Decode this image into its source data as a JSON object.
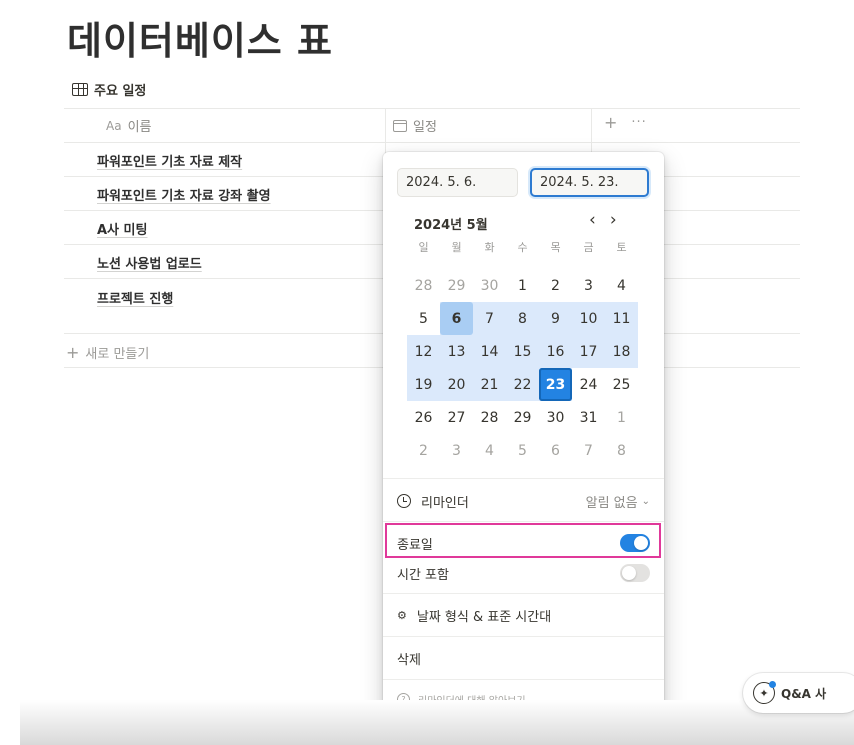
{
  "page": {
    "title": "데이터베이스 표"
  },
  "view": {
    "name": "주요 일정"
  },
  "table": {
    "name_column": {
      "icon_text": "Aa",
      "label": "이름"
    },
    "date_column": {
      "label": "일정"
    },
    "add_column": "+",
    "more": "···",
    "rows": [
      {
        "name": "파워포인트 기초 자료 제작"
      },
      {
        "name": "파워포인트 기초 자료 강좌 촬영"
      },
      {
        "name": "A사 미팅"
      },
      {
        "name": "노션 사용법 업로드"
      },
      {
        "name": "프로젝트 진행"
      }
    ],
    "new_row": "새로 만들기"
  },
  "date_picker": {
    "start_value": "2024. 5. 6.",
    "end_value": "2024. 5. 23.",
    "month_label": "2024년 5월",
    "prev": "‹",
    "next": "›",
    "weekdays": [
      "일",
      "월",
      "화",
      "수",
      "목",
      "금",
      "토"
    ],
    "weeks": [
      [
        "28",
        "29",
        "30",
        "1",
        "2",
        "3",
        "4"
      ],
      [
        "5",
        "6",
        "7",
        "8",
        "9",
        "10",
        "11"
      ],
      [
        "12",
        "13",
        "14",
        "15",
        "16",
        "17",
        "18"
      ],
      [
        "19",
        "20",
        "21",
        "22",
        "23",
        "24",
        "25"
      ],
      [
        "26",
        "27",
        "28",
        "29",
        "30",
        "31",
        "1"
      ],
      [
        "2",
        "3",
        "4",
        "5",
        "6",
        "7",
        "8"
      ]
    ],
    "reminder_label": "리마인더",
    "reminder_value": "알림 없음",
    "end_date_label": "종료일",
    "end_date_enabled": true,
    "include_time_label": "시간 포함",
    "include_time_enabled": false,
    "format_label": "날짜 형식 & 표준 시간대",
    "delete_label": "삭제",
    "help_label": "리마인더에 대해 알아보기"
  },
  "assistant": {
    "label": "Q&A 사"
  },
  "colors": {
    "accent": "#2383e2",
    "range": "#dbe9fb",
    "highlight": "#e0399a"
  }
}
